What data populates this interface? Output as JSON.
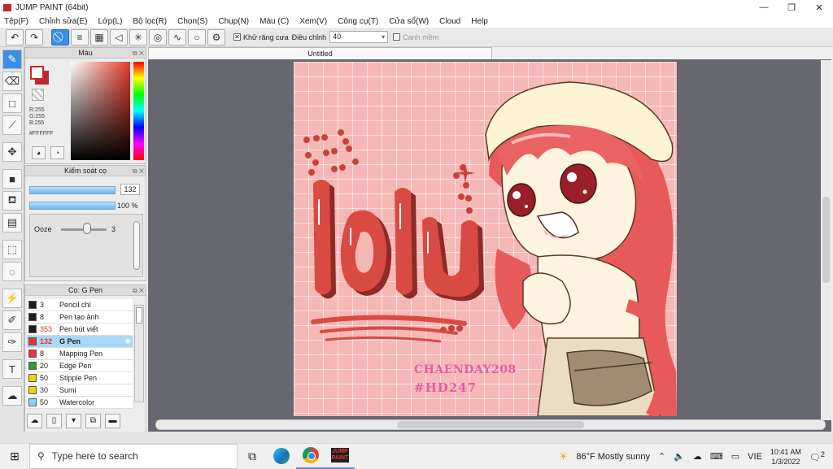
{
  "window": {
    "title": "JUMP PAINT (64bit)",
    "minimize": "—",
    "restore": "❐",
    "close": "✕"
  },
  "menu": [
    "Tệp(F)",
    "Chỉnh sửa(E)",
    "Lớp(L)",
    "Bộ lọc(R)",
    "Chọn(S)",
    "Chụp(N)",
    "Màu (C)",
    "Xem(V)",
    "Công cụ(T)",
    "Cửa sổ(W)",
    "Cloud",
    "Help"
  ],
  "toolbar": {
    "antialias_label": "Khử răng cưa",
    "adjust_label": "Điều chỉnh",
    "adjust_value": "40",
    "smooth_label": "Canh mềm"
  },
  "color_panel": {
    "title": "Màu",
    "r": "R:255",
    "g": "G:255",
    "b": "B:255",
    "hex": "#FFFFFF",
    "fg_color": "#ffffff",
    "bg_color": "#b92a2f"
  },
  "brush_control": {
    "title": "Kiểm soát cọ",
    "size_value": "132",
    "opacity_value": "100 %",
    "ooze_label": "Ooze",
    "ooze_value": "3"
  },
  "brush_list": {
    "title": "Cọ: G Pen",
    "items": [
      {
        "size": "3",
        "name": "Pencil chì",
        "color": "#1e1e1e"
      },
      {
        "size": "8",
        "name": "Pen tạo ảnh",
        "color": "#1e1e1e"
      },
      {
        "size": "353",
        "name": "Pen bút viết",
        "color": "#1e1e1e"
      },
      {
        "size": "132",
        "name": "G Pen",
        "color": "#e8323a",
        "selected": true
      },
      {
        "size": "8",
        "name": "Mapping Pen",
        "color": "#e8323a"
      },
      {
        "size": "20",
        "name": "Edge Pen",
        "color": "#2e9a2e"
      },
      {
        "size": "50",
        "name": "Stipple Pen",
        "color": "#e8d800"
      },
      {
        "size": "30",
        "name": "Sumi",
        "color": "#e8d800"
      },
      {
        "size": "50",
        "name": "Watercolor",
        "color": "#8ad4f2"
      }
    ]
  },
  "document": {
    "tab_title": "Untitled",
    "canvas_text_1": "CHAENDAY208",
    "canvas_text_2": "#HD247"
  },
  "taskbar": {
    "search_placeholder": "Type here to search",
    "weather": "86°F  Mostly sunny",
    "lang": "VIE",
    "time": "10:41 AM",
    "date": "1/3/2022",
    "notifications": "2"
  }
}
